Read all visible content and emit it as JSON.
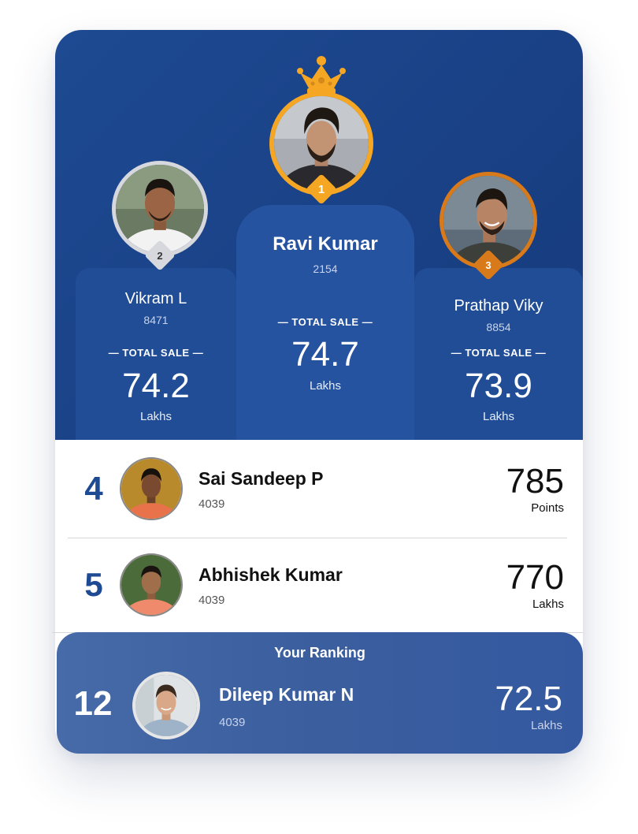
{
  "podium": {
    "first": {
      "rank": "1",
      "name": "Ravi Kumar",
      "id": "2154",
      "label": "TOTAL SALE",
      "value": "74.7",
      "unit": "Lakhs",
      "avatar": "user-avatar-photo"
    },
    "second": {
      "rank": "2",
      "name": "Vikram L",
      "id": "8471",
      "label": "TOTAL SALE",
      "value": "74.2",
      "unit": "Lakhs",
      "avatar": "user-avatar-photo"
    },
    "third": {
      "rank": "3",
      "name": "Prathap Viky",
      "id": "8854",
      "label": "TOTAL SALE",
      "value": "73.9",
      "unit": "Lakhs",
      "avatar": "user-avatar-photo"
    }
  },
  "list": [
    {
      "rank": "4",
      "name": "Sai Sandeep P",
      "id": "4039",
      "value": "785",
      "unit": "Points"
    },
    {
      "rank": "5",
      "name": "Abhishek Kumar",
      "id": "4039",
      "value": "770",
      "unit": "Lakhs"
    }
  ],
  "your_ranking": {
    "title": "Your Ranking",
    "rank": "12",
    "name": "Dileep Kumar N",
    "id": "4039",
    "value": "72.5",
    "unit": "Lakhs"
  },
  "colors": {
    "primary": "#1d4a92",
    "gold": "#f5a623",
    "silver": "#d6d8de",
    "bronze": "#d97a1a"
  },
  "icons": {
    "crown": "crown-icon"
  }
}
